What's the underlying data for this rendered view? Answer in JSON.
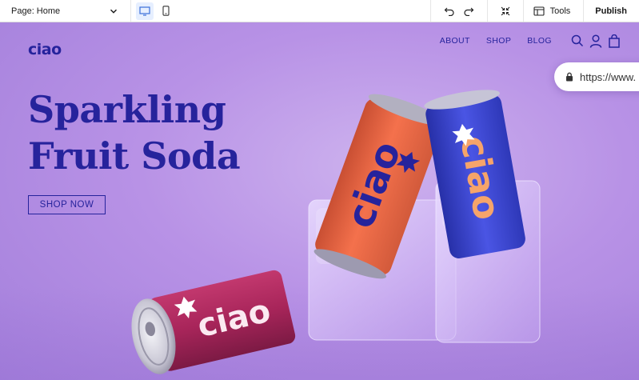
{
  "toolbar": {
    "page_label": "Page: Home",
    "tools_label": "Tools",
    "publish_label": "Publish"
  },
  "site": {
    "logo": "ciao",
    "nav": [
      "ABOUT",
      "SHOP",
      "BLOG"
    ],
    "headline_line1": "Sparkling",
    "headline_line2": "Fruit Soda",
    "cta": "SHOP NOW",
    "url_text": "https://www.",
    "can_brand": "ciao"
  },
  "colors": {
    "accent": "#26239c",
    "background": "#b892e6",
    "can_orange": "#f0623f",
    "can_blue": "#3a45d6",
    "can_maroon": "#a8255a"
  },
  "icons": [
    "chevron-down-icon",
    "desktop-icon",
    "mobile-icon",
    "undo-icon",
    "redo-icon",
    "zoom-out-icon",
    "tools-icon",
    "search-icon",
    "user-icon",
    "bag-icon",
    "lock-icon"
  ]
}
